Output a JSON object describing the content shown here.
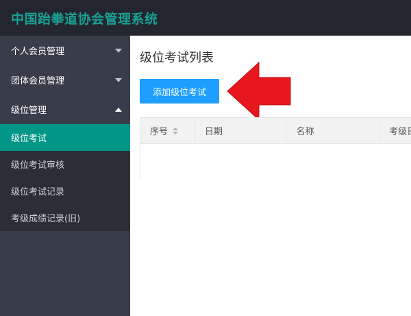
{
  "header": {
    "title": "中国跆拳道协会管理系统"
  },
  "sidebar": {
    "items": [
      {
        "label": "个人会员管理"
      },
      {
        "label": "团体会员管理"
      },
      {
        "label": "级位管理"
      }
    ],
    "subitems": [
      {
        "label": "级位考试"
      },
      {
        "label": "级位考试审核"
      },
      {
        "label": "级位考试记录"
      },
      {
        "label": "考级成绩记录(旧)"
      }
    ]
  },
  "main": {
    "title": "级位考试列表",
    "add_button": "添加级位考试",
    "table": {
      "columns": [
        "序号",
        "日期",
        "名称",
        "考级日"
      ]
    }
  },
  "colors": {
    "header_bg": "#23262e",
    "brand": "#1aa094",
    "sidebar_bg": "#393d49",
    "active": "#009688",
    "button": "#1e9fff",
    "arrow": "#e8161d"
  }
}
